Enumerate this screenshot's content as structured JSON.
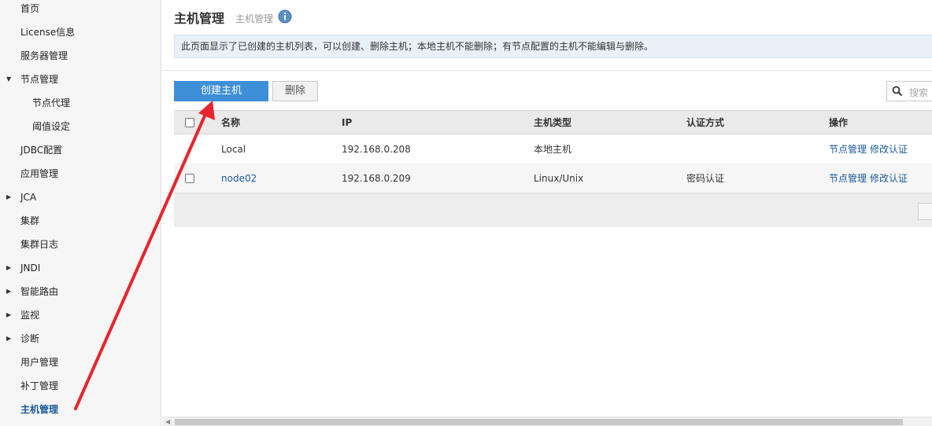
{
  "sidebar": {
    "items": [
      {
        "label": "首页"
      },
      {
        "label": "License信息"
      },
      {
        "label": "服务器管理"
      },
      {
        "label": "节点管理"
      },
      {
        "label": "节点代理"
      },
      {
        "label": "阈值设定"
      },
      {
        "label": "JDBC配置"
      },
      {
        "label": "应用管理"
      },
      {
        "label": "JCA"
      },
      {
        "label": "集群"
      },
      {
        "label": "集群日志"
      },
      {
        "label": "JNDI"
      },
      {
        "label": "智能路由"
      },
      {
        "label": "监视"
      },
      {
        "label": "诊断"
      },
      {
        "label": "用户管理"
      },
      {
        "label": "补丁管理"
      },
      {
        "label": "主机管理"
      }
    ]
  },
  "header": {
    "title": "主机管理",
    "subtitle": "主机管理"
  },
  "info_text": "此页面显示了已创建的主机列表，可以创建、删除主机；本地主机不能删除；有节点配置的主机不能编辑与删除。",
  "toolbar": {
    "create_label": "创建主机",
    "delete_label": "删除",
    "search_placeholder": "搜索"
  },
  "table": {
    "headers": {
      "name": "名称",
      "ip": "IP",
      "type": "主机类型",
      "auth": "认证方式",
      "ops": "操作"
    },
    "rows": [
      {
        "name": "Local",
        "ip": "192.168.0.208",
        "type": "本地主机",
        "auth": "",
        "op1": "节点管理",
        "op2": "修改认证"
      },
      {
        "name": "node02",
        "ip": "192.168.0.209",
        "type": "Linux/Unix",
        "auth": "密码认证",
        "op1": "节点管理",
        "op2": "修改认证"
      }
    ]
  },
  "colors": {
    "accent": "#3d8fd8",
    "link": "#1a5a9c",
    "annotation_arrow": "#e8242c"
  }
}
